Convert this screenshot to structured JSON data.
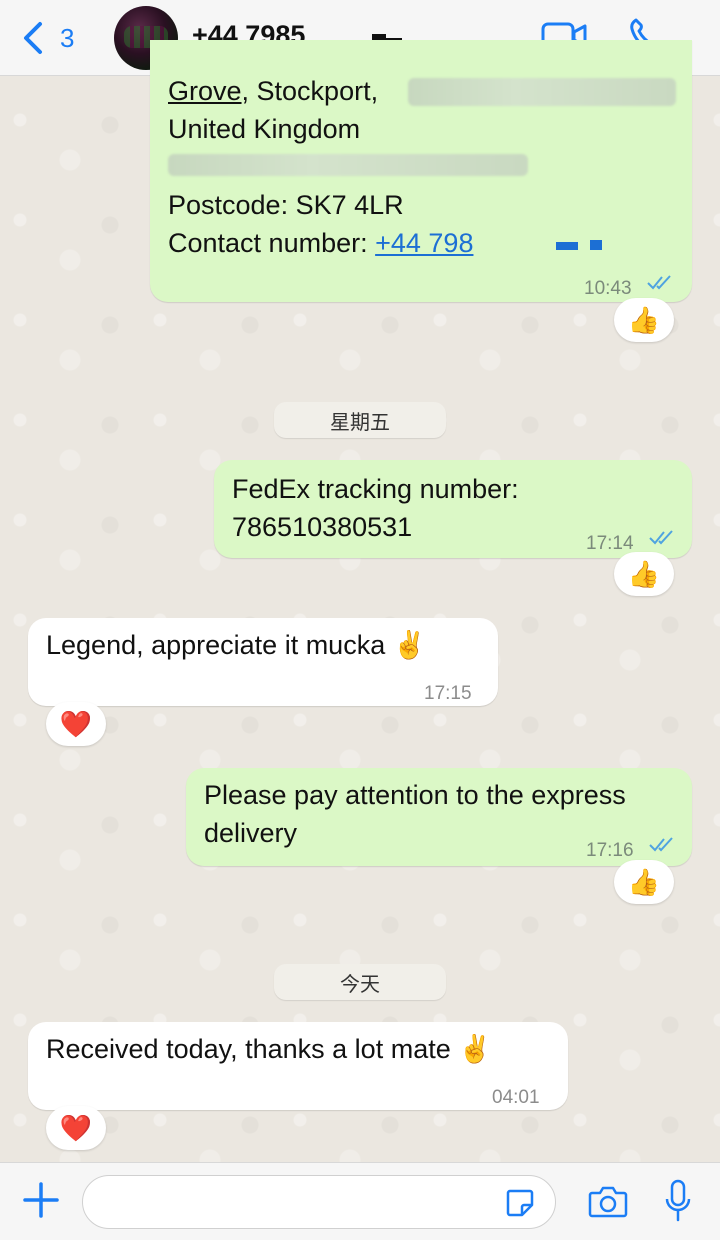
{
  "header": {
    "back_count": "3",
    "contact_name": "+44 7985"
  },
  "messages": {
    "m1": {
      "line1_a": "Grove",
      "line1_b": ", Stockport,",
      "line2": "United Kingdom",
      "line4": "Postcode: SK7 4LR",
      "line5_label": "Contact number: ",
      "line5_link": "+44 798",
      "time": "10:43",
      "reaction": "👍"
    },
    "date1": "星期五",
    "m2": {
      "line1": "FedEx tracking number:",
      "line2": "786510380531",
      "time": "17:14",
      "reaction": "👍"
    },
    "m3": {
      "text": "Legend, appreciate it mucka ✌️",
      "time": "17:15",
      "reaction": "❤️"
    },
    "m4": {
      "line1": "Please pay attention to the express",
      "line2": "delivery",
      "time": "17:16",
      "reaction": "👍"
    },
    "date2": "今天",
    "m5": {
      "text": "Received today, thanks a lot mate ✌️",
      "time": "04:01",
      "reaction": "❤️"
    }
  },
  "composer": {
    "placeholder": ""
  },
  "colors": {
    "accent": "#1b7df5",
    "outgoing_bubble": "#dbf8c6",
    "incoming_bubble": "#ffffff",
    "read_ticks": "#4fa3e0"
  }
}
